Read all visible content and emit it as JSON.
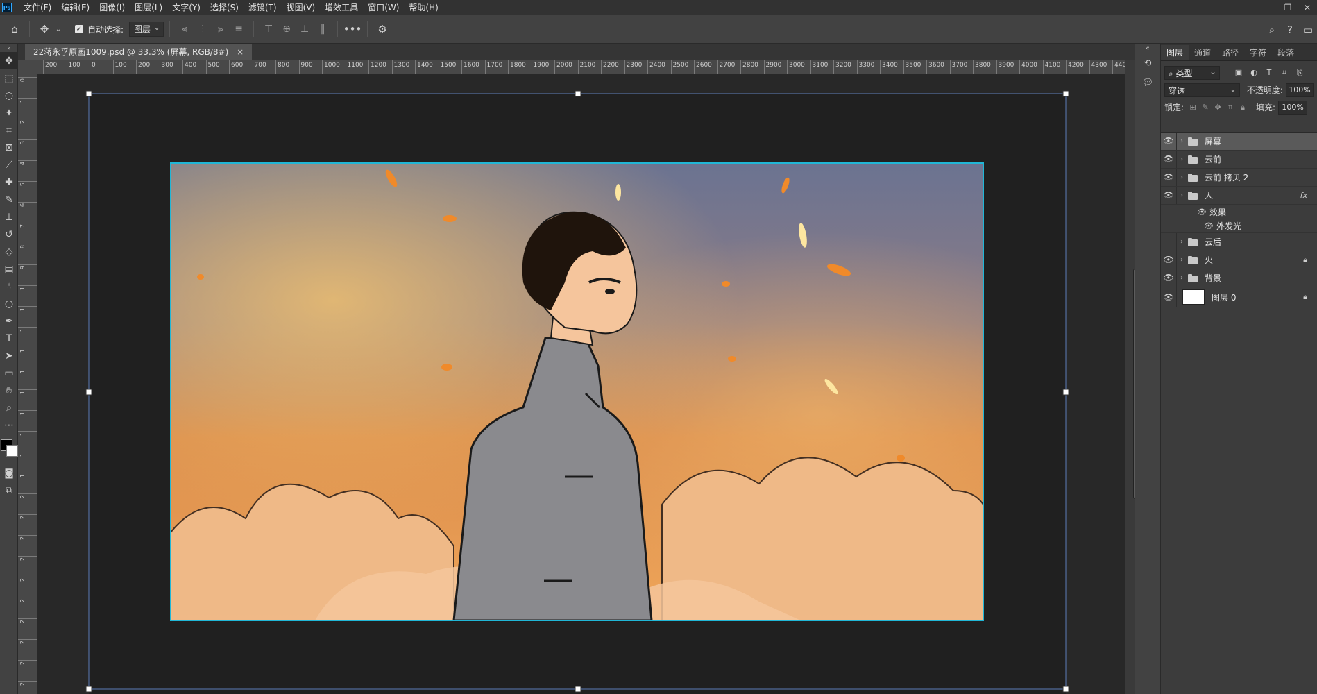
{
  "app": {
    "logo": "Ps",
    "menus": [
      "文件(F)",
      "编辑(E)",
      "图像(I)",
      "图层(L)",
      "文字(Y)",
      "选择(S)",
      "滤镜(T)",
      "视图(V)",
      "增效工具",
      "窗口(W)",
      "帮助(H)"
    ]
  },
  "window_controls": {
    "minimize": "—",
    "restore": "❐",
    "close": "✕"
  },
  "options": {
    "auto_select_label": "自动选择:",
    "auto_select_checked": "✓",
    "target_value": "图层",
    "more_label": "•••"
  },
  "document": {
    "tab_title": "22蒋永孚原画1009.psd @ 33.3% (屏幕, RGB/8#)",
    "tab_close": "×"
  },
  "ruler": {
    "top_labels": [
      "200",
      "100",
      "0",
      "100",
      "200",
      "300",
      "400",
      "500",
      "600",
      "700",
      "800",
      "900",
      "1000",
      "1100",
      "1200",
      "1300",
      "1400",
      "1500",
      "1600",
      "1700",
      "1800",
      "1900",
      "2000",
      "2100",
      "2200",
      "2300",
      "2400",
      "2500",
      "2600",
      "2700",
      "2800",
      "2900",
      "3000",
      "3100",
      "3200",
      "3300",
      "3400",
      "3500",
      "3600",
      "3700",
      "3800",
      "3900",
      "4000",
      "4100",
      "4200",
      "4300",
      "440"
    ],
    "left_labels": [
      "0",
      "1",
      "2",
      "3",
      "4",
      "5",
      "6",
      "7",
      "8",
      "9",
      "1",
      "1",
      "1",
      "1",
      "1",
      "1",
      "1",
      "1",
      "1",
      "1",
      "2",
      "2",
      "2",
      "2",
      "2",
      "2",
      "2",
      "2",
      "2",
      "2"
    ]
  },
  "layers_panel": {
    "tabs": [
      "图层",
      "通道",
      "路径",
      "字符",
      "段落"
    ],
    "active_tab": "图层",
    "filter_label": "⌕ 类型",
    "blend_mode": "穿透",
    "opacity_label": "不透明度:",
    "opacity_value": "100%",
    "lock_label": "锁定:",
    "fill_label": "填充:",
    "fill_value": "100%",
    "layers": [
      {
        "name": "屏幕",
        "visible": true,
        "selected": true,
        "type": "group"
      },
      {
        "name": "云前",
        "visible": true,
        "type": "group"
      },
      {
        "name": "云前 拷贝 2",
        "visible": true,
        "type": "group"
      },
      {
        "name": "人",
        "visible": true,
        "type": "group",
        "fx": "fx"
      },
      {
        "name": "云后",
        "visible": false,
        "type": "group"
      },
      {
        "name": "火",
        "visible": true,
        "type": "group",
        "locked": true
      },
      {
        "name": "背景",
        "visible": true,
        "type": "group"
      },
      {
        "name": "图层 0",
        "visible": true,
        "type": "pixel",
        "locked": true
      }
    ],
    "effects_label": "效果",
    "effect_name": "外发光"
  },
  "colors": {
    "accent": "#31a8ff",
    "selection_border": "#20b6d6",
    "bounding_box": "#5b7db8"
  }
}
